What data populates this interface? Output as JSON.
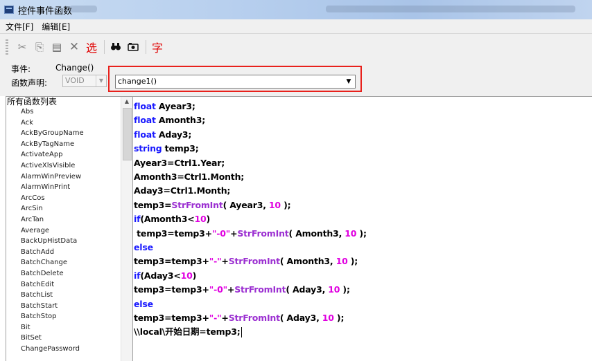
{
  "window": {
    "title": "控件事件函数"
  },
  "menu": {
    "items": [
      "文件[F]",
      "编辑[E]"
    ]
  },
  "toolbar": {
    "buttons": [
      {
        "name": "cut-icon",
        "glyph": "✂"
      },
      {
        "name": "copy-icon",
        "glyph": "⎘"
      },
      {
        "name": "paste-icon",
        "glyph": "▤"
      },
      {
        "name": "delete-icon",
        "glyph": "✕"
      },
      {
        "name": "select-icon",
        "glyph": "选"
      },
      {
        "name": "find-icon",
        "glyph": "🔍"
      },
      {
        "name": "replace-icon",
        "glyph": "⌕"
      },
      {
        "name": "font-icon",
        "glyph": "字"
      }
    ],
    "select_label": "选",
    "font_label": "字"
  },
  "event": {
    "label": "事件:",
    "value": "Change()"
  },
  "declaration": {
    "label": "函数声明:",
    "return_type": "VOID",
    "signature": "change1()"
  },
  "function_list": {
    "header": "所有函数列表",
    "items": [
      "Abs",
      "Ack",
      "AckByGroupName",
      "AckByTagName",
      "ActivateApp",
      "ActiveXlsVisible",
      "AlarmWinPreview",
      "AlarmWinPrint",
      "ArcCos",
      "ArcSin",
      "ArcTan",
      "Average",
      "BackUpHistData",
      "BatchAdd",
      "BatchChange",
      "BatchDelete",
      "BatchEdit",
      "BatchList",
      "BatchStart",
      "BatchStop",
      "Bit",
      "BitSet",
      "ChangePassword"
    ]
  },
  "code_lines": [
    [
      {
        "t": "kw",
        "v": "float"
      },
      {
        "t": "txt",
        "v": " Ayear3;"
      }
    ],
    [
      {
        "t": "kw",
        "v": "float"
      },
      {
        "t": "txt",
        "v": " Amonth3;"
      }
    ],
    [
      {
        "t": "kw",
        "v": "float"
      },
      {
        "t": "txt",
        "v": " Aday3;"
      }
    ],
    [
      {
        "t": "kw",
        "v": "string"
      },
      {
        "t": "txt",
        "v": " temp3;"
      }
    ],
    [
      {
        "t": "txt",
        "v": "Ayear3=Ctrl1.Year;"
      }
    ],
    [
      {
        "t": "txt",
        "v": "Amonth3=Ctrl1.Month;"
      }
    ],
    [
      {
        "t": "txt",
        "v": "Aday3=Ctrl1.Month;"
      }
    ],
    [
      {
        "t": "txt",
        "v": "temp3="
      },
      {
        "t": "fn",
        "v": "StrFromInt"
      },
      {
        "t": "txt",
        "v": "( Ayear3, "
      },
      {
        "t": "num",
        "v": "10"
      },
      {
        "t": "txt",
        "v": " );"
      }
    ],
    [
      {
        "t": "kw",
        "v": "if"
      },
      {
        "t": "txt",
        "v": "(Amonth3<"
      },
      {
        "t": "num",
        "v": "10"
      },
      {
        "t": "txt",
        "v": ")"
      }
    ],
    [
      {
        "t": "txt",
        "v": " temp3=temp3+"
      },
      {
        "t": "str",
        "v": "\"-0\""
      },
      {
        "t": "txt",
        "v": "+"
      },
      {
        "t": "fn",
        "v": "StrFromInt"
      },
      {
        "t": "txt",
        "v": "( Amonth3, "
      },
      {
        "t": "num",
        "v": "10"
      },
      {
        "t": "txt",
        "v": " );"
      }
    ],
    [
      {
        "t": "kw",
        "v": "else"
      }
    ],
    [
      {
        "t": "txt",
        "v": "temp3=temp3+"
      },
      {
        "t": "str",
        "v": "\"-\""
      },
      {
        "t": "txt",
        "v": "+"
      },
      {
        "t": "fn",
        "v": "StrFromInt"
      },
      {
        "t": "txt",
        "v": "( Amonth3, "
      },
      {
        "t": "num",
        "v": "10"
      },
      {
        "t": "txt",
        "v": " );"
      }
    ],
    [
      {
        "t": "kw",
        "v": "if"
      },
      {
        "t": "txt",
        "v": "(Aday3<"
      },
      {
        "t": "num",
        "v": "10"
      },
      {
        "t": "txt",
        "v": ")"
      }
    ],
    [
      {
        "t": "txt",
        "v": "temp3=temp3+"
      },
      {
        "t": "str",
        "v": "\"-0\""
      },
      {
        "t": "txt",
        "v": "+"
      },
      {
        "t": "fn",
        "v": "StrFromInt"
      },
      {
        "t": "txt",
        "v": "( Aday3, "
      },
      {
        "t": "num",
        "v": "10"
      },
      {
        "t": "txt",
        "v": " );"
      }
    ],
    [
      {
        "t": "kw",
        "v": "else"
      }
    ],
    [
      {
        "t": "txt",
        "v": "temp3=temp3+"
      },
      {
        "t": "str",
        "v": "\"-\""
      },
      {
        "t": "txt",
        "v": "+"
      },
      {
        "t": "fn",
        "v": "StrFromInt"
      },
      {
        "t": "txt",
        "v": "( Aday3, "
      },
      {
        "t": "num",
        "v": "10"
      },
      {
        "t": "txt",
        "v": " );"
      }
    ],
    [
      {
        "t": "txt",
        "v": "\\\\local\\开始日期=temp3;"
      }
    ]
  ],
  "colors": {
    "keyword": "#1a1aff",
    "function": "#9b2fd1",
    "literal": "#e000e0",
    "highlight": "#e8211c"
  }
}
